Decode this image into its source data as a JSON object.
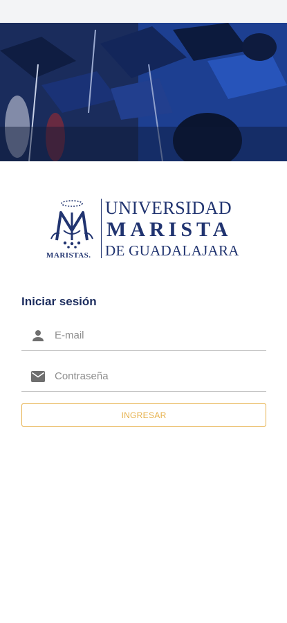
{
  "brand": {
    "name_line1": "UNIVERSIDAD",
    "name_line2": "MARISTA",
    "name_line3": "DE GUADALAJARA",
    "emblem_caption": "MARISTAS."
  },
  "login": {
    "title": "Iniciar sesión",
    "email_placeholder": "E-mail",
    "password_placeholder": "Contraseña",
    "submit_label": "INGRESAR"
  },
  "icons": {
    "email_field": "person-icon",
    "password_field": "mail-icon"
  },
  "colors": {
    "brand_navy": "#213470",
    "title_navy": "#1c2d5e",
    "accent_gold": "#e6b04a",
    "field_line": "#c4c4c4",
    "icon_gray": "#6f6f6f"
  }
}
